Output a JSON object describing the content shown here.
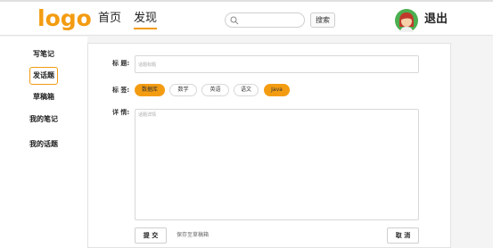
{
  "header": {
    "logo": "logo",
    "nav": [
      {
        "label": "首页"
      },
      {
        "label": "发现"
      }
    ],
    "search": {
      "placeholder": "",
      "button_label": "搜索"
    },
    "logout_label": "退出"
  },
  "sidebar": {
    "items": [
      {
        "label": "写笔记"
      },
      {
        "label": "发话题"
      },
      {
        "label": "草稿箱"
      },
      {
        "label": "我的笔记"
      },
      {
        "label": "我的话题"
      }
    ],
    "active": "发话题"
  },
  "form": {
    "title_label": "标 题:",
    "title_placeholder": "话题标题",
    "tags_label": "标 签:",
    "tags": [
      {
        "label": "数据库",
        "selected": true
      },
      {
        "label": "数学",
        "selected": false
      },
      {
        "label": "英语",
        "selected": false
      },
      {
        "label": "语文",
        "selected": false
      },
      {
        "label": "Java",
        "selected": true
      }
    ],
    "detail_label": "详 情:",
    "detail_placeholder": "话题详情",
    "submit_label": "提 交",
    "draft_label": "保存至草稿箱",
    "cancel_label": "取 消"
  },
  "colors": {
    "accent": "#f39c12"
  }
}
